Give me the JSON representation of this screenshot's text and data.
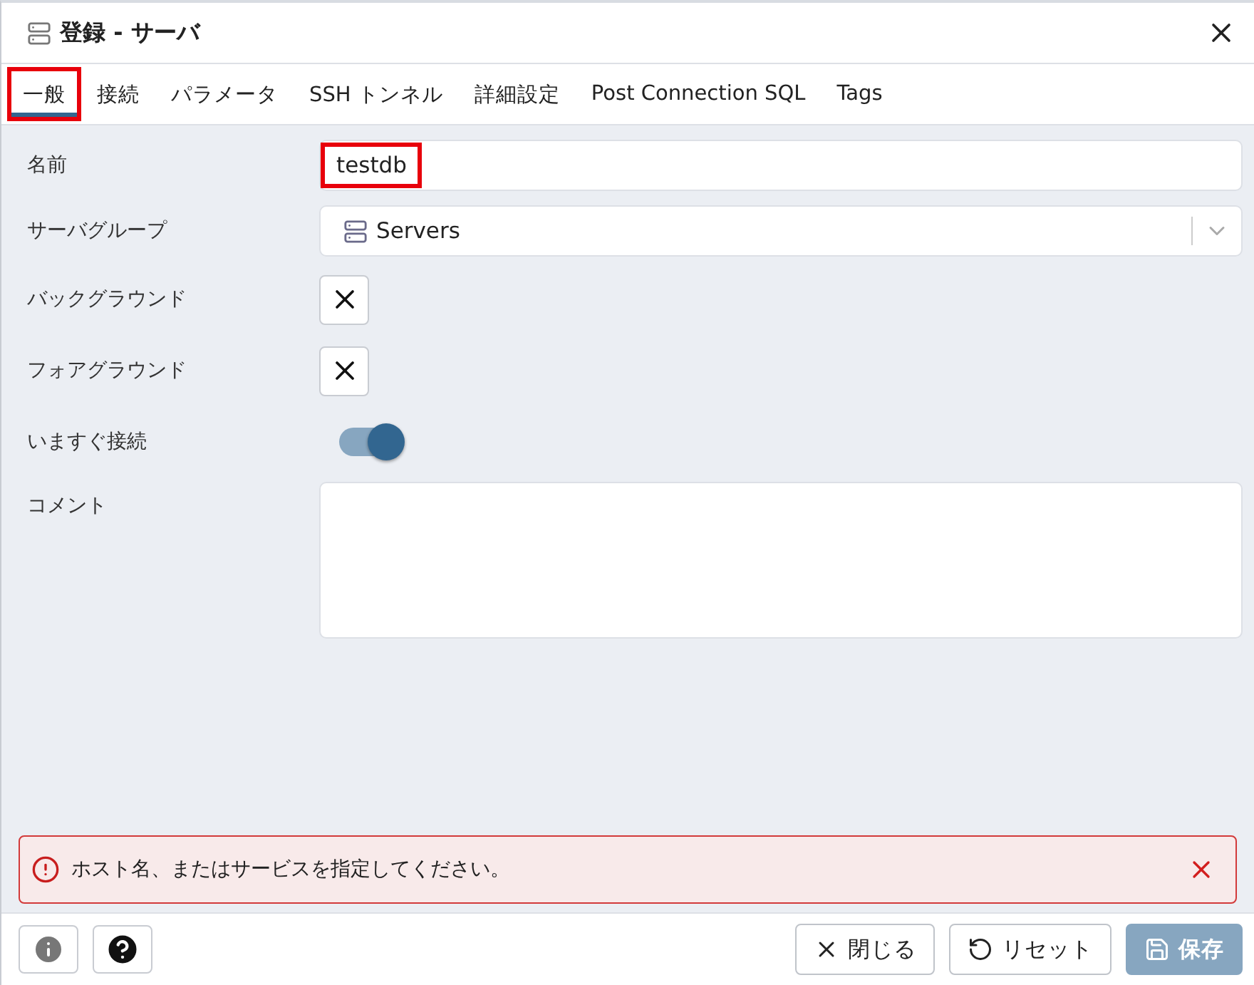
{
  "window": {
    "title": "登録 - サーバ"
  },
  "tabs": [
    {
      "label": "一般",
      "selected": true,
      "annotated": true
    },
    {
      "label": "接続",
      "selected": false,
      "annotated": false
    },
    {
      "label": "パラメータ",
      "selected": false,
      "annotated": false
    },
    {
      "label": "SSH トンネル",
      "selected": false,
      "annotated": false
    },
    {
      "label": "詳細設定",
      "selected": false,
      "annotated": false
    },
    {
      "label": "Post Connection SQL",
      "selected": false,
      "annotated": false
    },
    {
      "label": "Tags",
      "selected": false,
      "annotated": false
    }
  ],
  "fields": [
    {
      "kind": "text",
      "label": "名前",
      "value": "testdb",
      "annotated": true
    },
    {
      "kind": "select",
      "label": "サーバグループ",
      "value": "Servers"
    },
    {
      "kind": "color",
      "label": "バックグラウンド"
    },
    {
      "kind": "color",
      "label": "フォアグラウンド"
    },
    {
      "kind": "switch",
      "label": "いますぐ接続",
      "on": true
    },
    {
      "kind": "textarea",
      "label": "コメント"
    }
  ],
  "error": {
    "message": "ホスト名、またはサービスを指定してください。"
  },
  "buttons": [
    {
      "label": "閉じる",
      "kind": "close",
      "disabled": false
    },
    {
      "label": "リセット",
      "kind": "reset",
      "disabled": false
    },
    {
      "label": "保存",
      "kind": "save",
      "disabled": true
    }
  ]
}
